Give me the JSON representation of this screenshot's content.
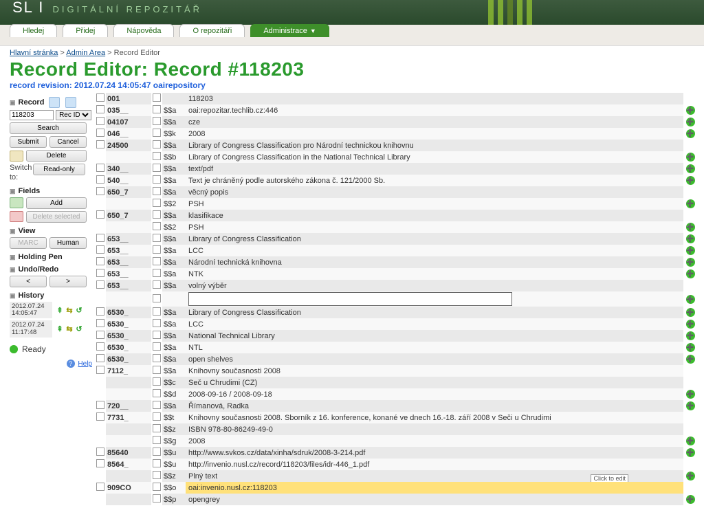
{
  "header": {
    "logo": "SL I",
    "logo_sub": "DIGITÁLNÍ REPOZITÁŘ"
  },
  "tabs": {
    "hledej": "Hledej",
    "pridej": "Přidej",
    "napoveda": "Nápověda",
    "orepozitari": "O repozitáři",
    "administrace": "Administrace"
  },
  "breadcrumb": {
    "home": "Hlavní stránka",
    "admin": "Admin Area",
    "current": "Record Editor"
  },
  "page_title": "Record Editor: Record #118203",
  "revision": "record revision: 2012.07.24 14:05:47 oairepository",
  "record_label": "Record",
  "sidebar": {
    "recid_value": "118203",
    "recid_sel": "Rec ID",
    "search": "Search",
    "submit": "Submit",
    "cancel": "Cancel",
    "delete": "Delete",
    "readonly": "Read-only",
    "switch_to": "Switch to:",
    "fields": "Fields",
    "add": "Add",
    "delete_selected": "Delete selected",
    "view": "View",
    "marc": "MARC",
    "human": "Human",
    "holdingpen": "Holding Pen",
    "undoredo": "Undo/Redo",
    "prev": "<",
    "next": ">",
    "history": "History",
    "hist1": "2012.07.24 14:05:47",
    "hist2": "2012.07.24 11:17:48",
    "ready": "Ready",
    "help": "Help"
  },
  "fields": [
    {
      "tag": "001",
      "subs": [
        {
          "sf": "",
          "val": "118203"
        }
      ],
      "plus": false
    },
    {
      "tag": "035__",
      "subs": [
        {
          "sf": "$$a",
          "val": "oai:repozitar.techlib.cz:446"
        }
      ],
      "plus": true
    },
    {
      "tag": "04107",
      "subs": [
        {
          "sf": "$$a",
          "val": "cze"
        }
      ],
      "plus": true
    },
    {
      "tag": "046__",
      "subs": [
        {
          "sf": "$$k",
          "val": "2008"
        }
      ],
      "plus": true
    },
    {
      "tag": "24500",
      "subs": [
        {
          "sf": "$$a",
          "val": "Library of Congress Classification pro Národní technickou knihovnu"
        },
        {
          "sf": "$$b",
          "val": "Library of Congress Classification in the National Technical Library"
        }
      ],
      "plus": true
    },
    {
      "tag": "340__",
      "subs": [
        {
          "sf": "$$a",
          "val": "text/pdf"
        }
      ],
      "plus": true
    },
    {
      "tag": "540__",
      "subs": [
        {
          "sf": "$$a",
          "val": "Text je chráněný podle autorského zákona č. 121/2000 Sb."
        }
      ],
      "plus": true
    },
    {
      "tag": "650_7",
      "subs": [
        {
          "sf": "$$a",
          "val": "věcný popis"
        },
        {
          "sf": "$$2",
          "val": "PSH"
        }
      ],
      "plus": true
    },
    {
      "tag": "650_7",
      "subs": [
        {
          "sf": "$$a",
          "val": "klasifikace"
        },
        {
          "sf": "$$2",
          "val": "PSH"
        }
      ],
      "plus": true
    },
    {
      "tag": "653__",
      "subs": [
        {
          "sf": "$$a",
          "val": "Library of Congress Classification"
        }
      ],
      "plus": true
    },
    {
      "tag": "653__",
      "subs": [
        {
          "sf": "$$a",
          "val": "LCC"
        }
      ],
      "plus": true
    },
    {
      "tag": "653__",
      "subs": [
        {
          "sf": "$$a",
          "val": "Národní technická knihovna"
        }
      ],
      "plus": true
    },
    {
      "tag": "653__",
      "subs": [
        {
          "sf": "$$a",
          "val": "NTK"
        }
      ],
      "plus": true
    },
    {
      "tag": "653__",
      "subs": [
        {
          "sf": "$$a",
          "val": "volný výběr"
        },
        {
          "sf": "",
          "val": "",
          "edit": true
        }
      ],
      "plus": true
    },
    {
      "tag": "6530_",
      "subs": [
        {
          "sf": "$$a",
          "val": "Library of Congress Classification"
        }
      ],
      "plus": true
    },
    {
      "tag": "6530_",
      "subs": [
        {
          "sf": "$$a",
          "val": "LCC"
        }
      ],
      "plus": true
    },
    {
      "tag": "6530_",
      "subs": [
        {
          "sf": "$$a",
          "val": "National Technical Library"
        }
      ],
      "plus": true
    },
    {
      "tag": "6530_",
      "subs": [
        {
          "sf": "$$a",
          "val": "NTL"
        }
      ],
      "plus": true
    },
    {
      "tag": "6530_",
      "subs": [
        {
          "sf": "$$a",
          "val": "open shelves"
        }
      ],
      "plus": true
    },
    {
      "tag": "7112_",
      "subs": [
        {
          "sf": "$$a",
          "val": "Knihovny současnosti 2008"
        },
        {
          "sf": "$$c",
          "val": "Seč u Chrudimi (CZ)"
        },
        {
          "sf": "$$d",
          "val": "2008-09-16 / 2008-09-18"
        }
      ],
      "plus": true
    },
    {
      "tag": "720__",
      "subs": [
        {
          "sf": "$$a",
          "val": "Římanová, Radka"
        }
      ],
      "plus": true
    },
    {
      "tag": "7731_",
      "subs": [
        {
          "sf": "$$t",
          "val": "Knihovny současnosti 2008. Sborník z 16. konference, konané ve dnech 16.-18. září 2008 v Seči u Chrudimi"
        },
        {
          "sf": "$$z",
          "val": "ISBN 978-80-86249-49-0"
        },
        {
          "sf": "$$g",
          "val": "2008"
        }
      ],
      "plus": true
    },
    {
      "tag": "85640",
      "subs": [
        {
          "sf": "$$u",
          "val": "http://www.svkos.cz/data/xinha/sdruk/2008-3-214.pdf"
        }
      ],
      "plus": true
    },
    {
      "tag": "8564_",
      "subs": [
        {
          "sf": "$$u",
          "val": "http://invenio.nusl.cz/record/118203/files/idr-446_1.pdf"
        },
        {
          "sf": "$$z",
          "val": "Plný text",
          "tip": "Click to edit"
        }
      ],
      "plus": true
    },
    {
      "tag": "909CO",
      "subs": [
        {
          "sf": "$$o",
          "val": "oai:invenio.nusl.cz:118203",
          "hl": true
        },
        {
          "sf": "$$p",
          "val": "opengrey"
        }
      ],
      "plus": true
    }
  ]
}
